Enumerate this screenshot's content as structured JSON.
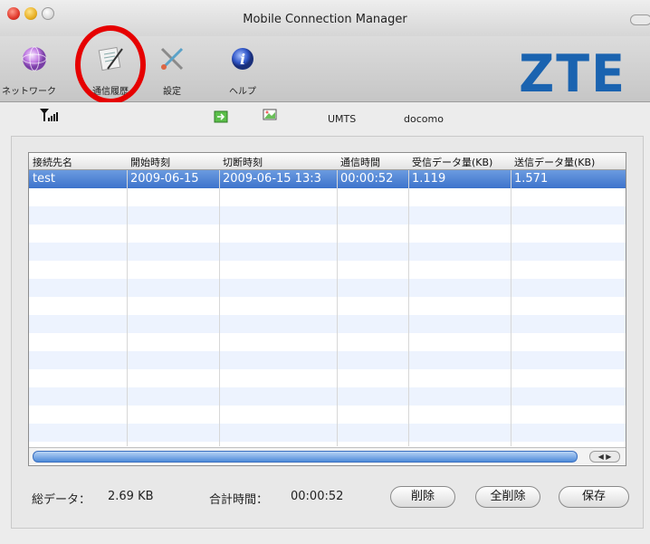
{
  "window": {
    "title": "Mobile Connection Manager",
    "brand": "ZTE"
  },
  "toolbar": {
    "network": "ネットワーク",
    "history": "通信履歴",
    "settings": "設定",
    "help": "ヘルプ"
  },
  "status": {
    "network_type": "UMTS",
    "carrier": "docomo"
  },
  "table": {
    "columns": [
      "接続先名",
      "開始時刻",
      "切断時刻",
      "通信時間",
      "受信データ量(KB)",
      "送信データ量(KB)"
    ],
    "rows": [
      [
        "test",
        "2009-06-15",
        "2009-06-15 13:3",
        "00:00:52",
        "1.119",
        "1.571"
      ]
    ]
  },
  "summary": {
    "total_data_label": "総データ：",
    "total_data_value": "2.69 KB",
    "total_time_label": "合計時間：",
    "total_time_value": "00:00:52"
  },
  "buttons": {
    "delete": "削除",
    "delete_all": "全削除",
    "save": "保存"
  },
  "colors": {
    "brand": "#1a63b0",
    "selection": "#3d73cc",
    "highlight_ring": "#e60000"
  }
}
